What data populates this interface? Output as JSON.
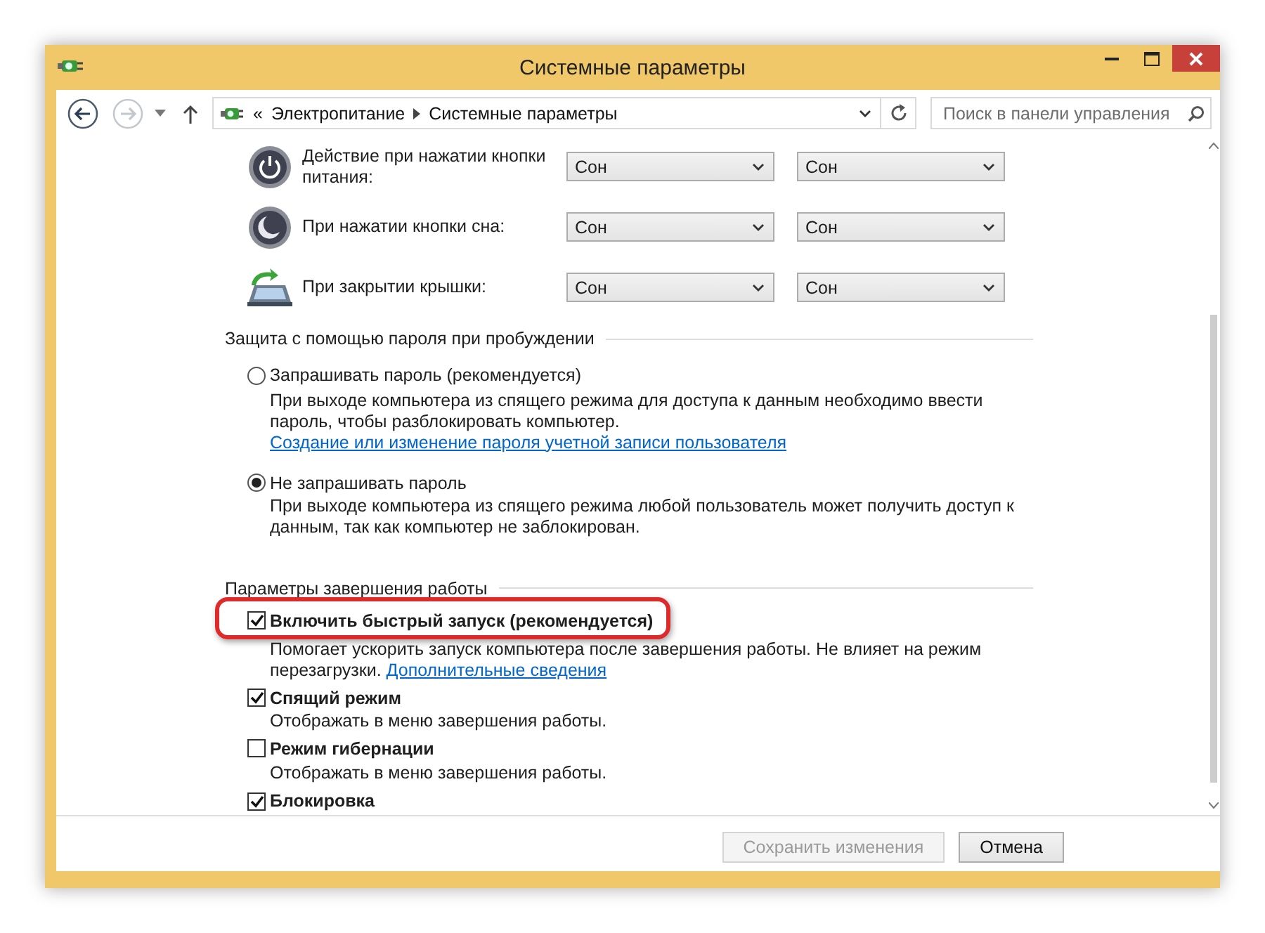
{
  "window": {
    "title": "Системные параметры"
  },
  "address_bar": {
    "overflow": "«",
    "path": [
      "Электропитание",
      "Системные параметры"
    ]
  },
  "search": {
    "placeholder": "Поиск в панели управления"
  },
  "power_rows": [
    {
      "kind": "power",
      "label": "Действие при нажатии кнопки питания:",
      "values": [
        "Сон",
        "Сон"
      ]
    },
    {
      "kind": "sleep",
      "label": "При нажатии кнопки сна:",
      "values": [
        "Сон",
        "Сон"
      ]
    },
    {
      "kind": "lid",
      "label": "При закрытии крышки:",
      "values": [
        "Сон",
        "Сон"
      ]
    }
  ],
  "password_section": {
    "title": "Защита с помощью пароля при пробуждении",
    "options": [
      {
        "label": "Запрашивать пароль (рекомендуется)",
        "selected": false,
        "description": "При выходе компьютера из спящего режима для доступа к данным необходимо ввести пароль, чтобы разблокировать компьютер.",
        "link": "Создание или изменение пароля учетной записи пользователя"
      },
      {
        "label": "Не запрашивать пароль",
        "selected": true,
        "description": "При выходе компьютера из спящего режима любой пользователь может получить доступ к данным, так как компьютер не заблокирован."
      }
    ]
  },
  "shutdown_section": {
    "title": "Параметры завершения работы",
    "options": [
      {
        "label": "Включить быстрый запуск (рекомендуется)",
        "checked": true,
        "highlighted": true,
        "description": "Помогает ускорить запуск компьютера после завершения работы. Не влияет на режим перезагрузки.",
        "link": "Дополнительные сведения"
      },
      {
        "label": "Спящий режим",
        "checked": true,
        "highlighted": false,
        "description": "Отображать в меню завершения работы."
      },
      {
        "label": "Режим гибернации",
        "checked": false,
        "highlighted": false,
        "description": "Отображать в меню завершения работы."
      },
      {
        "label": "Блокировка",
        "checked": true,
        "highlighted": false
      }
    ]
  },
  "buttons": [
    {
      "label": "Сохранить изменения",
      "disabled": true
    },
    {
      "label": "Отмена",
      "disabled": false
    }
  ]
}
